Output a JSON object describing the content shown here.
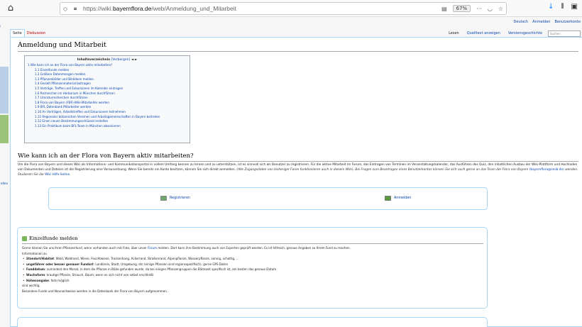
{
  "browser": {
    "url_prefix": "https://wiki.",
    "url_host": "bayernflora.de",
    "url_path": "/web/Anmeldung_und_Mitarbeit",
    "zoom": "67%",
    "more": "···"
  },
  "userbar": [
    "Deutsch",
    "Anmelden",
    "Benutzerkonto"
  ],
  "side_fragments": [
    "elten"
  ],
  "tabs": {
    "seite": "Seite",
    "diskussion": "Diskussion",
    "lesen": "Lesen",
    "quelltext": "Quelltext anzeigen",
    "versionen": "Versionsgeschichte",
    "search_placeholder": "Suchen"
  },
  "page_title": "Anmeldung und Mitarbeit",
  "toc": {
    "title": "Inhaltsverzeichnis",
    "toggle": "[Verbergen]",
    "arrows": "◄ ►",
    "items": [
      {
        "text": "1 Wie kann ich an der Flora von Bayern aktiv mitarbeiten?",
        "level": 1
      },
      {
        "text": "1.1 Einzelfunde melden",
        "level": 2
      },
      {
        "text": "1.2 Größere Datenmengen melden",
        "level": 2
      },
      {
        "text": "1.3 Pflanzenbilder und Bildideen melden",
        "level": 2
      },
      {
        "text": "1.4 Gezielt Pflanzenmaterial beitragen",
        "level": 2
      },
      {
        "text": "1.5 Vorträge, Treffen und Exkursionen im Kalender eintragen",
        "level": 2
      },
      {
        "text": "1.6 Recherchen im Herbarium in München durchführen",
        "level": 2
      },
      {
        "text": "1.7 Literaturrecherchen durchführen",
        "level": 2
      },
      {
        "text": "1.8 Flora von Bayern (FBF)-Wiki-Mitarbeiter werden",
        "level": 2
      },
      {
        "text": "1.9 BFL Datenbank Mitarbeiter werden",
        "level": 2
      },
      {
        "text": "1.10 An Vorträgen, Arbeitstreffen und Exkursionen teilnehmen",
        "level": 2
      },
      {
        "text": "1.11 Regionaler botanischen Vereinen und Arbeitsgemeinschaften in Bayern beitreten",
        "level": 2
      },
      {
        "text": "1.12 Einen neuen Bestimmungsschlüssel erstellen",
        "level": 2
      },
      {
        "text": "1.13 Ein Praktikum beim BFL-Team in München absolvieren",
        "level": 2
      }
    ]
  },
  "section": {
    "heading": "Wie kann ich an der Flora von Bayern aktiv mitarbeiten?",
    "para1": "Um die Flora von Bayern und dieses Wiki als Informations- und Kommunikationsportal in vollem Umfang kennen zu lernen und zu unterstützen, ist es sinnvoll sich als Benutzer zu registrieren. Für die aktive Mitarbeit im Forum, das Eintragen von Terminen im Veranstaltungskalender, das Ausführen des Quiz, den inhaltlichen Ausbau der Wiki-Plattform und",
    "para2": "Hochladen von Dokumenten und Dateien ist die Registrierung eine Voraussetzung. Wenn Sie bereits ein Konto besitzen, können Sie sich direkt anmelden. ",
    "para2_italic": "(Alle Zugangsdaten von bisheriger Foren funktionieren auch in diesem Wiki). Bei Fragen zum Beantragen eines Benutzerkontos können Sie sich auch gerne an das Team der Flora von Bayern",
    "para3_link": "(bayernflora@snsb.de)",
    "para3_rest": " wenden. Studieren Sie die ",
    "para3_link2": "Wiki Hilfe-Seiten",
    "para3_end": "."
  },
  "buttons": {
    "register": "Registrieren",
    "login": "Anmelden"
  },
  "box1": {
    "heading": "Einzelfunde melden",
    "intro_a": "Gerne können Sie uns Ihren Pflanzenfund, wenn vorhanden auch mit Foto, über unser ",
    "intro_link": "Forum",
    "intro_b": " melden. Dort kann ihre Bestimmung auch von Experten geprüft werden. Es ist hilfreich, genaue Angaben zu Ihrem Fund zu machen.",
    "informationen": "Informationen zu",
    "items": [
      {
        "label": "Standort/Habitat",
        "text": ": Wald, Waldrand, Wiese, Feuchtwiese, Trockenhang, Ackerrand, Straßenrand, Alpenpflanze, Wasserpflanze, sonnig, schattig, ..."
      },
      {
        "label": "ungefährer oder besser genauer Fundort",
        "text": ": Landkreis, Stadt, Umgebung, etc (einige Pflanzen sind regionsspezifisch), gerne GPS Daten"
      },
      {
        "label": "Funddatum",
        "text": ": zumindest den Monat, in dem die Pflanze in Blüte gefunden wurde, da bei einigen Pflanzengruppen die Blütezeit spezifisch ist, am besten das genaue Datum"
      },
      {
        "label": "Wuchsform",
        "text": ": krautige Pflanze, Strauch, Baum; wenn es sich nicht von selbst erschließt"
      },
      {
        "label": "Höhenangabe",
        "text": ": falls möglich"
      }
    ],
    "sind": "sind wichtig.",
    "footer": "Besondere Funde und Neunachweise werden in die Datenbank der Flora von Bayern aufgenommen."
  }
}
